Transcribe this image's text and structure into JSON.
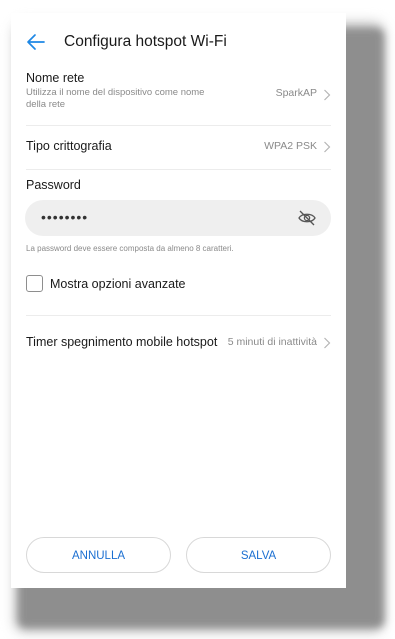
{
  "header": {
    "title": "Configura hotspot Wi-Fi",
    "back_icon": "back-arrow-icon"
  },
  "network_name": {
    "title": "Nome rete",
    "subtitle": "Utilizza il nome del dispositivo come nome della rete",
    "value": "SparkAP"
  },
  "encryption": {
    "title": "Tipo crittografia",
    "value": "WPA2 PSK"
  },
  "password": {
    "label": "Password",
    "value": "••••••••",
    "hint": "La password deve essere composta da almeno 8 caratteri.",
    "toggle_icon": "eye-off-icon"
  },
  "advanced": {
    "label": "Mostra opzioni avanzate",
    "checked": false
  },
  "timer": {
    "title": "Timer spegnimento mobile hotspot",
    "value": "5 minuti di inattività"
  },
  "buttons": {
    "cancel": "ANNULLA",
    "save": "SALVA"
  },
  "colors": {
    "accent": "#1b6fd1",
    "back_arrow": "#1e88e5",
    "secondary_text": "#8a8a8a"
  }
}
